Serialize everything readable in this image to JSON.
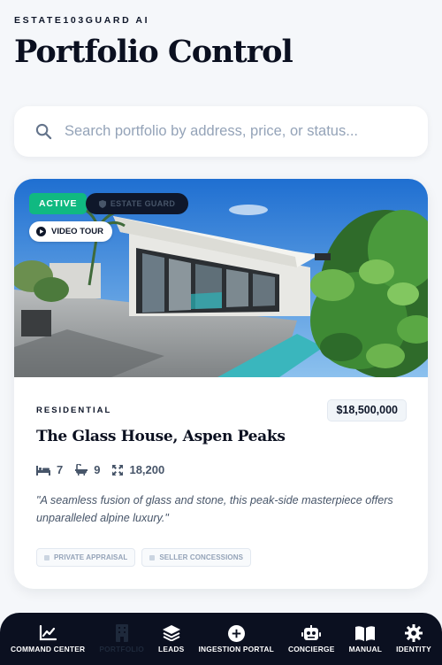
{
  "app": {
    "brand": "ESTATE103GUARD AI",
    "title": "Portfolio Control"
  },
  "search": {
    "placeholder": "Search portfolio by address, price, or status...",
    "icon": "search-icon"
  },
  "listing": {
    "status": "ACTIVE",
    "guard_badge": "ESTATE GUARD",
    "tour_label": "VIDEO TOUR",
    "category": "RESIDENTIAL",
    "price": "$18,500,000",
    "name": "The Glass House, Aspen Peaks",
    "beds": "7",
    "baths": "9",
    "sqft": "18,200",
    "quote": "\"A seamless fusion of glass and stone, this peak-side masterpiece offers unparalleled alpine luxury.\"",
    "tags": [
      "PRIVATE APPRAISAL",
      "SELLER CONCESSIONS"
    ]
  },
  "nav": [
    {
      "label": "COMMAND CENTER",
      "icon": "chart-line-icon"
    },
    {
      "label": "PORTFOLIO",
      "icon": "building-icon",
      "active": true
    },
    {
      "label": "LEADS",
      "icon": "layers-icon"
    },
    {
      "label": "INGESTION PORTAL",
      "icon": "plus-circle-icon"
    },
    {
      "label": "CONCIERGE",
      "icon": "robot-icon"
    },
    {
      "label": "MANUAL",
      "icon": "book-icon"
    },
    {
      "label": "IDENTITY",
      "icon": "gear-icon"
    }
  ],
  "colors": {
    "accent": "#10b981",
    "dark": "#0b1020",
    "background": "#f5f7fa",
    "muted": "#475569"
  }
}
